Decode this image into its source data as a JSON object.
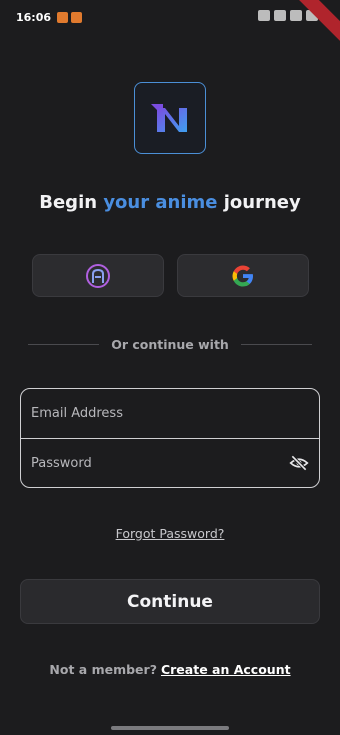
{
  "status_bar": {
    "time": "16:06",
    "notification_icons": [
      "app-notification-icon",
      "app-notification-icon"
    ],
    "system_icons": [
      "alarm-icon",
      "wifi-icon",
      "signal-icon",
      "battery-icon"
    ]
  },
  "app": {
    "logo_icon": "brand-logo-icon",
    "headline_prefix": "Begin ",
    "headline_highlight": "your anime",
    "headline_suffix": " journey"
  },
  "social": {
    "buttons": [
      {
        "icon": "github-icon"
      },
      {
        "icon": "google-icon"
      }
    ]
  },
  "divider": {
    "label": "Or continue with"
  },
  "form": {
    "email_placeholder": "Email Address",
    "password_placeholder": "Password",
    "password_toggle_icon": "eye-off-icon",
    "forgot_label": "Forgot Password?",
    "continue_label": "Continue"
  },
  "signup": {
    "prompt": "Not a member?",
    "link_label": "Create an Account"
  },
  "colors": {
    "background": "#1c1c1e",
    "accent": "#4a8ee0",
    "border": "#cfcfd2"
  }
}
